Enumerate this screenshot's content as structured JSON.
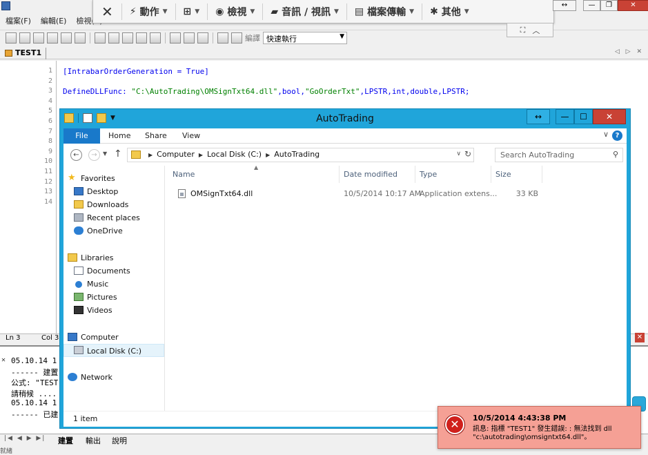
{
  "app": {
    "menu": [
      "檔案(F)",
      "編輯(E)",
      "檢視(V)"
    ],
    "compile_label": "編譯",
    "run_combo": "快速執行",
    "doc_tab": "TEST1",
    "editor": {
      "lines": [
        {
          "n": "1",
          "code": "[IntrabarOrderGeneration = True]"
        },
        {
          "n": "2",
          "code": ""
        },
        {
          "n": "3",
          "code": "DefineDLLFunc: \"C:\\AutoTrading\\OMSignTxt64.dll\",bool,\"GoOrderTxt\",LPSTR,int,double,LPSTR;"
        },
        {
          "n": "4",
          "code": ""
        },
        {
          "n": "5",
          "code": ""
        },
        {
          "n": "6",
          "code": ""
        },
        {
          "n": "7",
          "code": ""
        },
        {
          "n": "8",
          "code": ""
        },
        {
          "n": "9",
          "code": ""
        },
        {
          "n": "10",
          "code": ""
        },
        {
          "n": "11",
          "code": ""
        },
        {
          "n": "12",
          "code": ""
        },
        {
          "n": "13",
          "code": ""
        },
        {
          "n": "14",
          "code": ""
        }
      ]
    },
    "status": {
      "ln": "Ln 3",
      "col": "Col 3"
    },
    "output_lines": [
      "05.10.14 1",
      "------ 建置",
      "公式: \"TEST",
      "請稍候 ....",
      "05.10.14 1",
      "------ 已建"
    ],
    "bottom_tabs": [
      "建置",
      "輸出",
      "說明"
    ],
    "bottom_tiny": "就緒"
  },
  "remote_toolbar": {
    "close_glyph": "✕",
    "items": [
      {
        "icon": "bolt-icon",
        "glyph": "⚡",
        "label": "動作"
      },
      {
        "icon": "windows-icon",
        "glyph": "⊞",
        "label": ""
      },
      {
        "icon": "eye-icon",
        "glyph": "◉",
        "label": "檢視"
      },
      {
        "icon": "chat-icon",
        "glyph": "▰",
        "label": "音訊 / 視訊"
      },
      {
        "icon": "file-transfer-icon",
        "glyph": "▤",
        "label": "檔案傳輸"
      },
      {
        "icon": "gear-icon",
        "glyph": "✱",
        "label": "其他"
      }
    ]
  },
  "explorer": {
    "title": "AutoTrading",
    "ribbon": {
      "file": "File",
      "tabs": [
        "Home",
        "Share",
        "View"
      ]
    },
    "address": [
      "Computer",
      "Local Disk (C:)",
      "AutoTrading"
    ],
    "search_placeholder": "Search AutoTrading",
    "nav": {
      "favorites": "Favorites",
      "favorites_items": [
        "Desktop",
        "Downloads",
        "Recent places",
        "OneDrive"
      ],
      "libraries": "Libraries",
      "libraries_items": [
        "Documents",
        "Music",
        "Pictures",
        "Videos"
      ],
      "computer": "Computer",
      "local_disk": "Local Disk (C:)",
      "network": "Network"
    },
    "columns": {
      "name": "Name",
      "date": "Date modified",
      "type": "Type",
      "size": "Size"
    },
    "files": [
      {
        "name": "OMSignTxt64.dll",
        "date": "10/5/2014 10:17 AM",
        "type": "Application extens...",
        "size": "33 KB"
      }
    ],
    "status": "1 item"
  },
  "toast": {
    "time": "10/5/2014 4:43:38 PM",
    "message": "訊息: 指標 \"TEST1\" 發生錯誤: : 無法找到 dll \"c:\\autotrading\\omsigntxt64.dll\"。"
  }
}
